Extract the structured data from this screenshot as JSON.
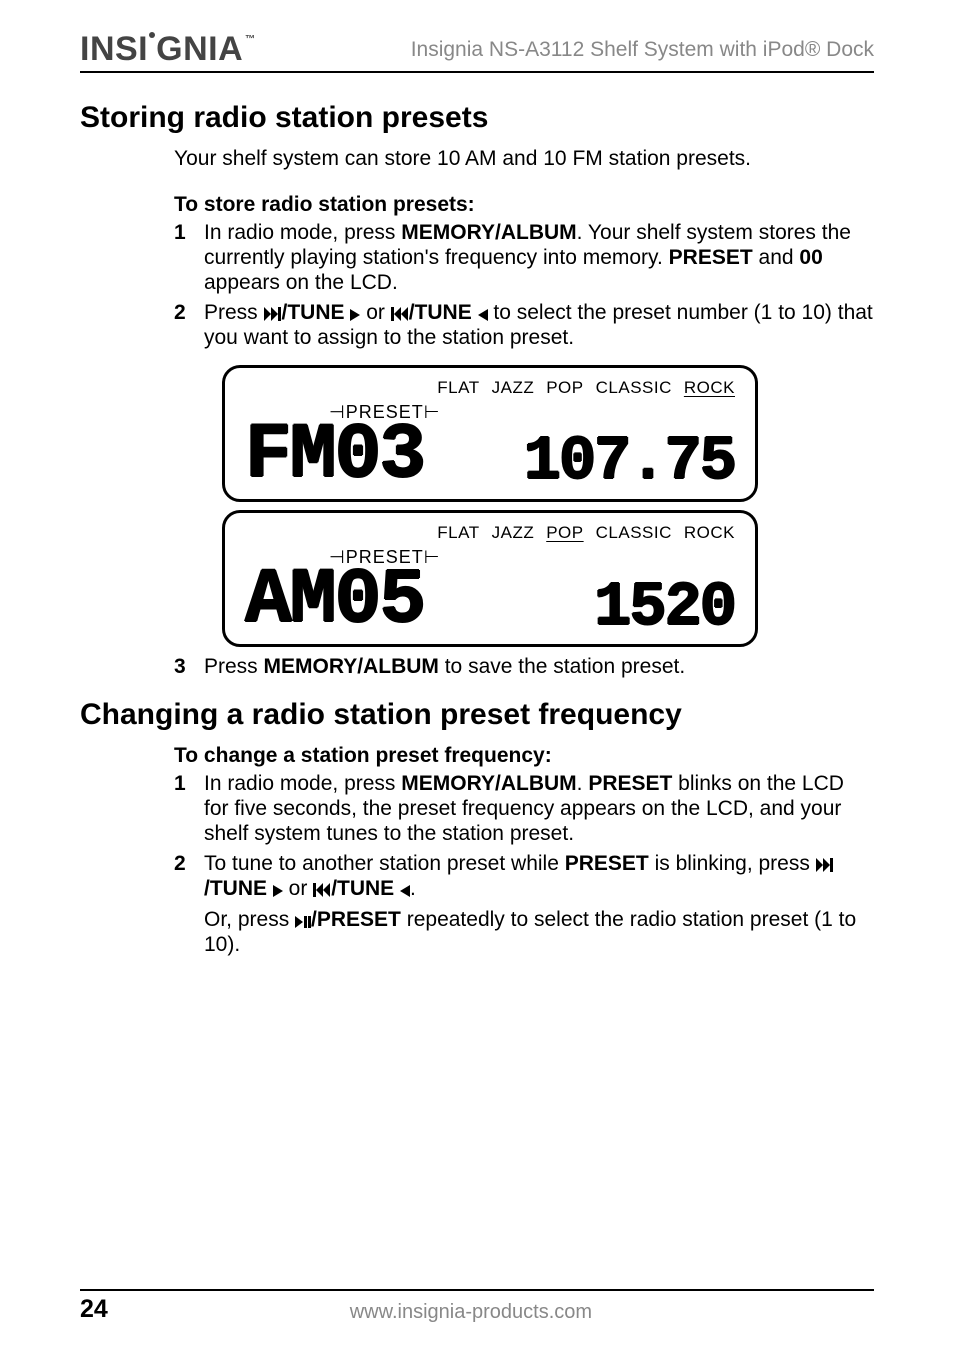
{
  "header": {
    "brand_main": "INSI",
    "brand_rest": "NIA",
    "tm": "™",
    "doc_title": "Insignia NS-A3112 Shelf System with iPod® Dock"
  },
  "section1": {
    "title": "Storing radio station presets",
    "intro": "Your shelf system can store 10 AM and 10 FM station presets.",
    "sub": "To store radio station presets:",
    "step1_a": "In radio mode, press ",
    "step1_b": "MEMORY/ALBUM",
    "step1_c": ". Your shelf system stores the currently playing station's frequency into memory. ",
    "step1_d": "PRESET",
    "step1_e": " and ",
    "step1_f": "00",
    "step1_g": " appears on the LCD.",
    "step2_a": "Press ",
    "step2_b": "/TUNE ",
    "step2_c": " or ",
    "step2_d": "/TUNE ",
    "step2_e": " to select the preset number (1 to 10) that you want to assign to the station preset.",
    "step3_a": "Press ",
    "step3_b": "MEMORY/ALBUM",
    "step3_c": " to save the station preset."
  },
  "lcd1": {
    "preset_label": "PRESET",
    "eq": {
      "flat": "FLAT",
      "jazz": "JAZZ",
      "pop": "POP",
      "classic": "CLASSIC",
      "rock": "ROCK",
      "active": "rock"
    },
    "left": "FM03",
    "right": "107.75"
  },
  "lcd2": {
    "preset_label": "PRESET",
    "eq": {
      "flat": "FLAT",
      "jazz": "JAZZ",
      "pop": "POP",
      "classic": "CLASSIC",
      "rock": "ROCK",
      "active": "pop"
    },
    "left": "AM05",
    "right": "1520"
  },
  "section2": {
    "title": "Changing a radio station preset frequency",
    "sub": "To change a station preset frequency:",
    "step1_a": "In radio mode, press ",
    "step1_b": "MEMORY/ALBUM",
    "step1_c": ". ",
    "step1_d": "PRESET",
    "step1_e": " blinks on the LCD for five seconds, the preset frequency appears on the LCD, and your shelf system tunes to the station preset.",
    "step2_a": "To tune to another station preset while ",
    "step2_b": "PRESET",
    "step2_c": " is blinking, press ",
    "step2_d": "/TUNE ",
    "step2_e": " or ",
    "step2_f": "/TUNE ",
    "step2_g": ".",
    "or_a": "Or, press ",
    "or_b": "/PRESET",
    "or_c": " repeatedly to select the radio station preset (1 to 10)."
  },
  "footer": {
    "page": "24",
    "url": "www.insignia-products.com"
  }
}
